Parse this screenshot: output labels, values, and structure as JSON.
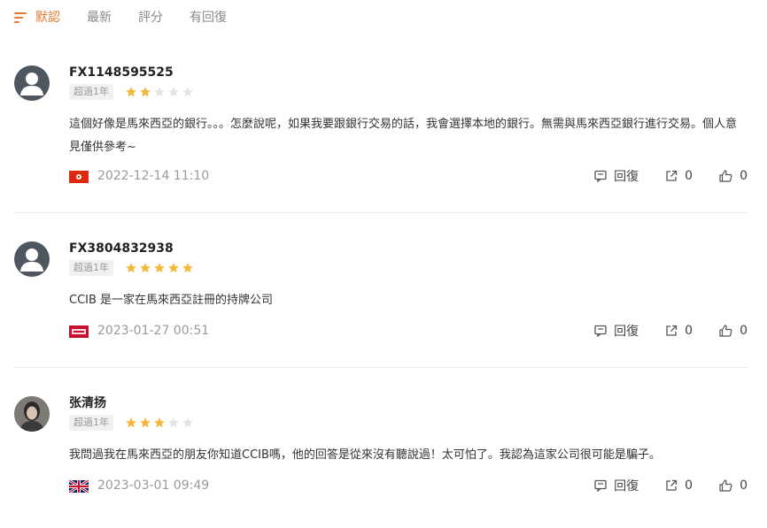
{
  "tabs": [
    {
      "label": "默認",
      "active": true,
      "icon": "sort-icon"
    },
    {
      "label": "最新",
      "active": false
    },
    {
      "label": "評分",
      "active": false
    },
    {
      "label": "有回復",
      "active": false
    }
  ],
  "colors": {
    "accent": "#e8772e",
    "star_on": "#f5b83a",
    "star_off": "#e3e3e3"
  },
  "reviews": [
    {
      "username": "FX1148595525",
      "badge": "超過1年",
      "rating": 2,
      "content": "這個好像是馬來西亞的銀行。。。怎麼說呢，如果我要跟銀行交易的話，我會選擇本地的銀行。無需與馬來西亞銀行進行交易。個人意見僅供參考~",
      "flag": "hong-kong-flag-icon",
      "date": "2022-12-14 11:10",
      "reply_label": "回復",
      "share_count": "0",
      "like_count": "0"
    },
    {
      "username": "FX3804832938",
      "badge": "超過1年",
      "rating": 5,
      "content": "CCIB 是一家在馬來西亞註冊的持牌公司",
      "flag": "taiwan-flag-icon",
      "date": "2023-01-27 00:51",
      "reply_label": "回復",
      "share_count": "0",
      "like_count": "0"
    },
    {
      "username": "张清扬",
      "badge": "超過1年",
      "rating": 3,
      "content": "我問過我在馬來西亞的朋友你知道CCIB嗎，他的回答是從來沒有聽說過！太可怕了。我認為這家公司很可能是騙子。",
      "flag": "uk-flag-icon",
      "date": "2023-03-01 09:49",
      "reply_label": "回復",
      "share_count": "0",
      "like_count": "0"
    }
  ]
}
